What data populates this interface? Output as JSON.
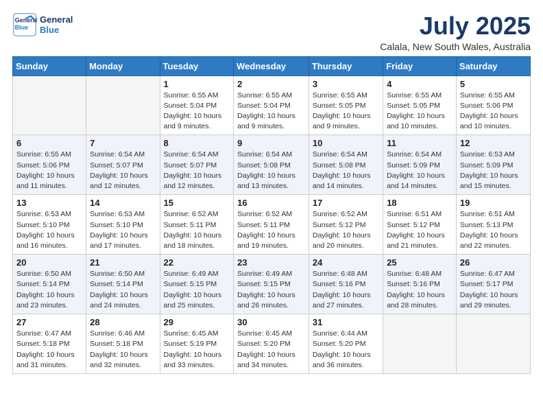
{
  "header": {
    "logo_line1": "General",
    "logo_line2": "Blue",
    "month": "July 2025",
    "location": "Calala, New South Wales, Australia"
  },
  "days_of_week": [
    "Sunday",
    "Monday",
    "Tuesday",
    "Wednesday",
    "Thursday",
    "Friday",
    "Saturday"
  ],
  "weeks": [
    [
      {
        "day": "",
        "info": ""
      },
      {
        "day": "",
        "info": ""
      },
      {
        "day": "1",
        "info": "Sunrise: 6:55 AM\nSunset: 5:04 PM\nDaylight: 10 hours\nand 9 minutes."
      },
      {
        "day": "2",
        "info": "Sunrise: 6:55 AM\nSunset: 5:04 PM\nDaylight: 10 hours\nand 9 minutes."
      },
      {
        "day": "3",
        "info": "Sunrise: 6:55 AM\nSunset: 5:05 PM\nDaylight: 10 hours\nand 9 minutes."
      },
      {
        "day": "4",
        "info": "Sunrise: 6:55 AM\nSunset: 5:05 PM\nDaylight: 10 hours\nand 10 minutes."
      },
      {
        "day": "5",
        "info": "Sunrise: 6:55 AM\nSunset: 5:06 PM\nDaylight: 10 hours\nand 10 minutes."
      }
    ],
    [
      {
        "day": "6",
        "info": "Sunrise: 6:55 AM\nSunset: 5:06 PM\nDaylight: 10 hours\nand 11 minutes."
      },
      {
        "day": "7",
        "info": "Sunrise: 6:54 AM\nSunset: 5:07 PM\nDaylight: 10 hours\nand 12 minutes."
      },
      {
        "day": "8",
        "info": "Sunrise: 6:54 AM\nSunset: 5:07 PM\nDaylight: 10 hours\nand 12 minutes."
      },
      {
        "day": "9",
        "info": "Sunrise: 6:54 AM\nSunset: 5:08 PM\nDaylight: 10 hours\nand 13 minutes."
      },
      {
        "day": "10",
        "info": "Sunrise: 6:54 AM\nSunset: 5:08 PM\nDaylight: 10 hours\nand 14 minutes."
      },
      {
        "day": "11",
        "info": "Sunrise: 6:54 AM\nSunset: 5:09 PM\nDaylight: 10 hours\nand 14 minutes."
      },
      {
        "day": "12",
        "info": "Sunrise: 6:53 AM\nSunset: 5:09 PM\nDaylight: 10 hours\nand 15 minutes."
      }
    ],
    [
      {
        "day": "13",
        "info": "Sunrise: 6:53 AM\nSunset: 5:10 PM\nDaylight: 10 hours\nand 16 minutes."
      },
      {
        "day": "14",
        "info": "Sunrise: 6:53 AM\nSunset: 5:10 PM\nDaylight: 10 hours\nand 17 minutes."
      },
      {
        "day": "15",
        "info": "Sunrise: 6:52 AM\nSunset: 5:11 PM\nDaylight: 10 hours\nand 18 minutes."
      },
      {
        "day": "16",
        "info": "Sunrise: 6:52 AM\nSunset: 5:11 PM\nDaylight: 10 hours\nand 19 minutes."
      },
      {
        "day": "17",
        "info": "Sunrise: 6:52 AM\nSunset: 5:12 PM\nDaylight: 10 hours\nand 20 minutes."
      },
      {
        "day": "18",
        "info": "Sunrise: 6:51 AM\nSunset: 5:12 PM\nDaylight: 10 hours\nand 21 minutes."
      },
      {
        "day": "19",
        "info": "Sunrise: 6:51 AM\nSunset: 5:13 PM\nDaylight: 10 hours\nand 22 minutes."
      }
    ],
    [
      {
        "day": "20",
        "info": "Sunrise: 6:50 AM\nSunset: 5:14 PM\nDaylight: 10 hours\nand 23 minutes."
      },
      {
        "day": "21",
        "info": "Sunrise: 6:50 AM\nSunset: 5:14 PM\nDaylight: 10 hours\nand 24 minutes."
      },
      {
        "day": "22",
        "info": "Sunrise: 6:49 AM\nSunset: 5:15 PM\nDaylight: 10 hours\nand 25 minutes."
      },
      {
        "day": "23",
        "info": "Sunrise: 6:49 AM\nSunset: 5:15 PM\nDaylight: 10 hours\nand 26 minutes."
      },
      {
        "day": "24",
        "info": "Sunrise: 6:48 AM\nSunset: 5:16 PM\nDaylight: 10 hours\nand 27 minutes."
      },
      {
        "day": "25",
        "info": "Sunrise: 6:48 AM\nSunset: 5:16 PM\nDaylight: 10 hours\nand 28 minutes."
      },
      {
        "day": "26",
        "info": "Sunrise: 6:47 AM\nSunset: 5:17 PM\nDaylight: 10 hours\nand 29 minutes."
      }
    ],
    [
      {
        "day": "27",
        "info": "Sunrise: 6:47 AM\nSunset: 5:18 PM\nDaylight: 10 hours\nand 31 minutes."
      },
      {
        "day": "28",
        "info": "Sunrise: 6:46 AM\nSunset: 5:18 PM\nDaylight: 10 hours\nand 32 minutes."
      },
      {
        "day": "29",
        "info": "Sunrise: 6:45 AM\nSunset: 5:19 PM\nDaylight: 10 hours\nand 33 minutes."
      },
      {
        "day": "30",
        "info": "Sunrise: 6:45 AM\nSunset: 5:20 PM\nDaylight: 10 hours\nand 34 minutes."
      },
      {
        "day": "31",
        "info": "Sunrise: 6:44 AM\nSunset: 5:20 PM\nDaylight: 10 hours\nand 36 minutes."
      },
      {
        "day": "",
        "info": ""
      },
      {
        "day": "",
        "info": ""
      }
    ]
  ]
}
